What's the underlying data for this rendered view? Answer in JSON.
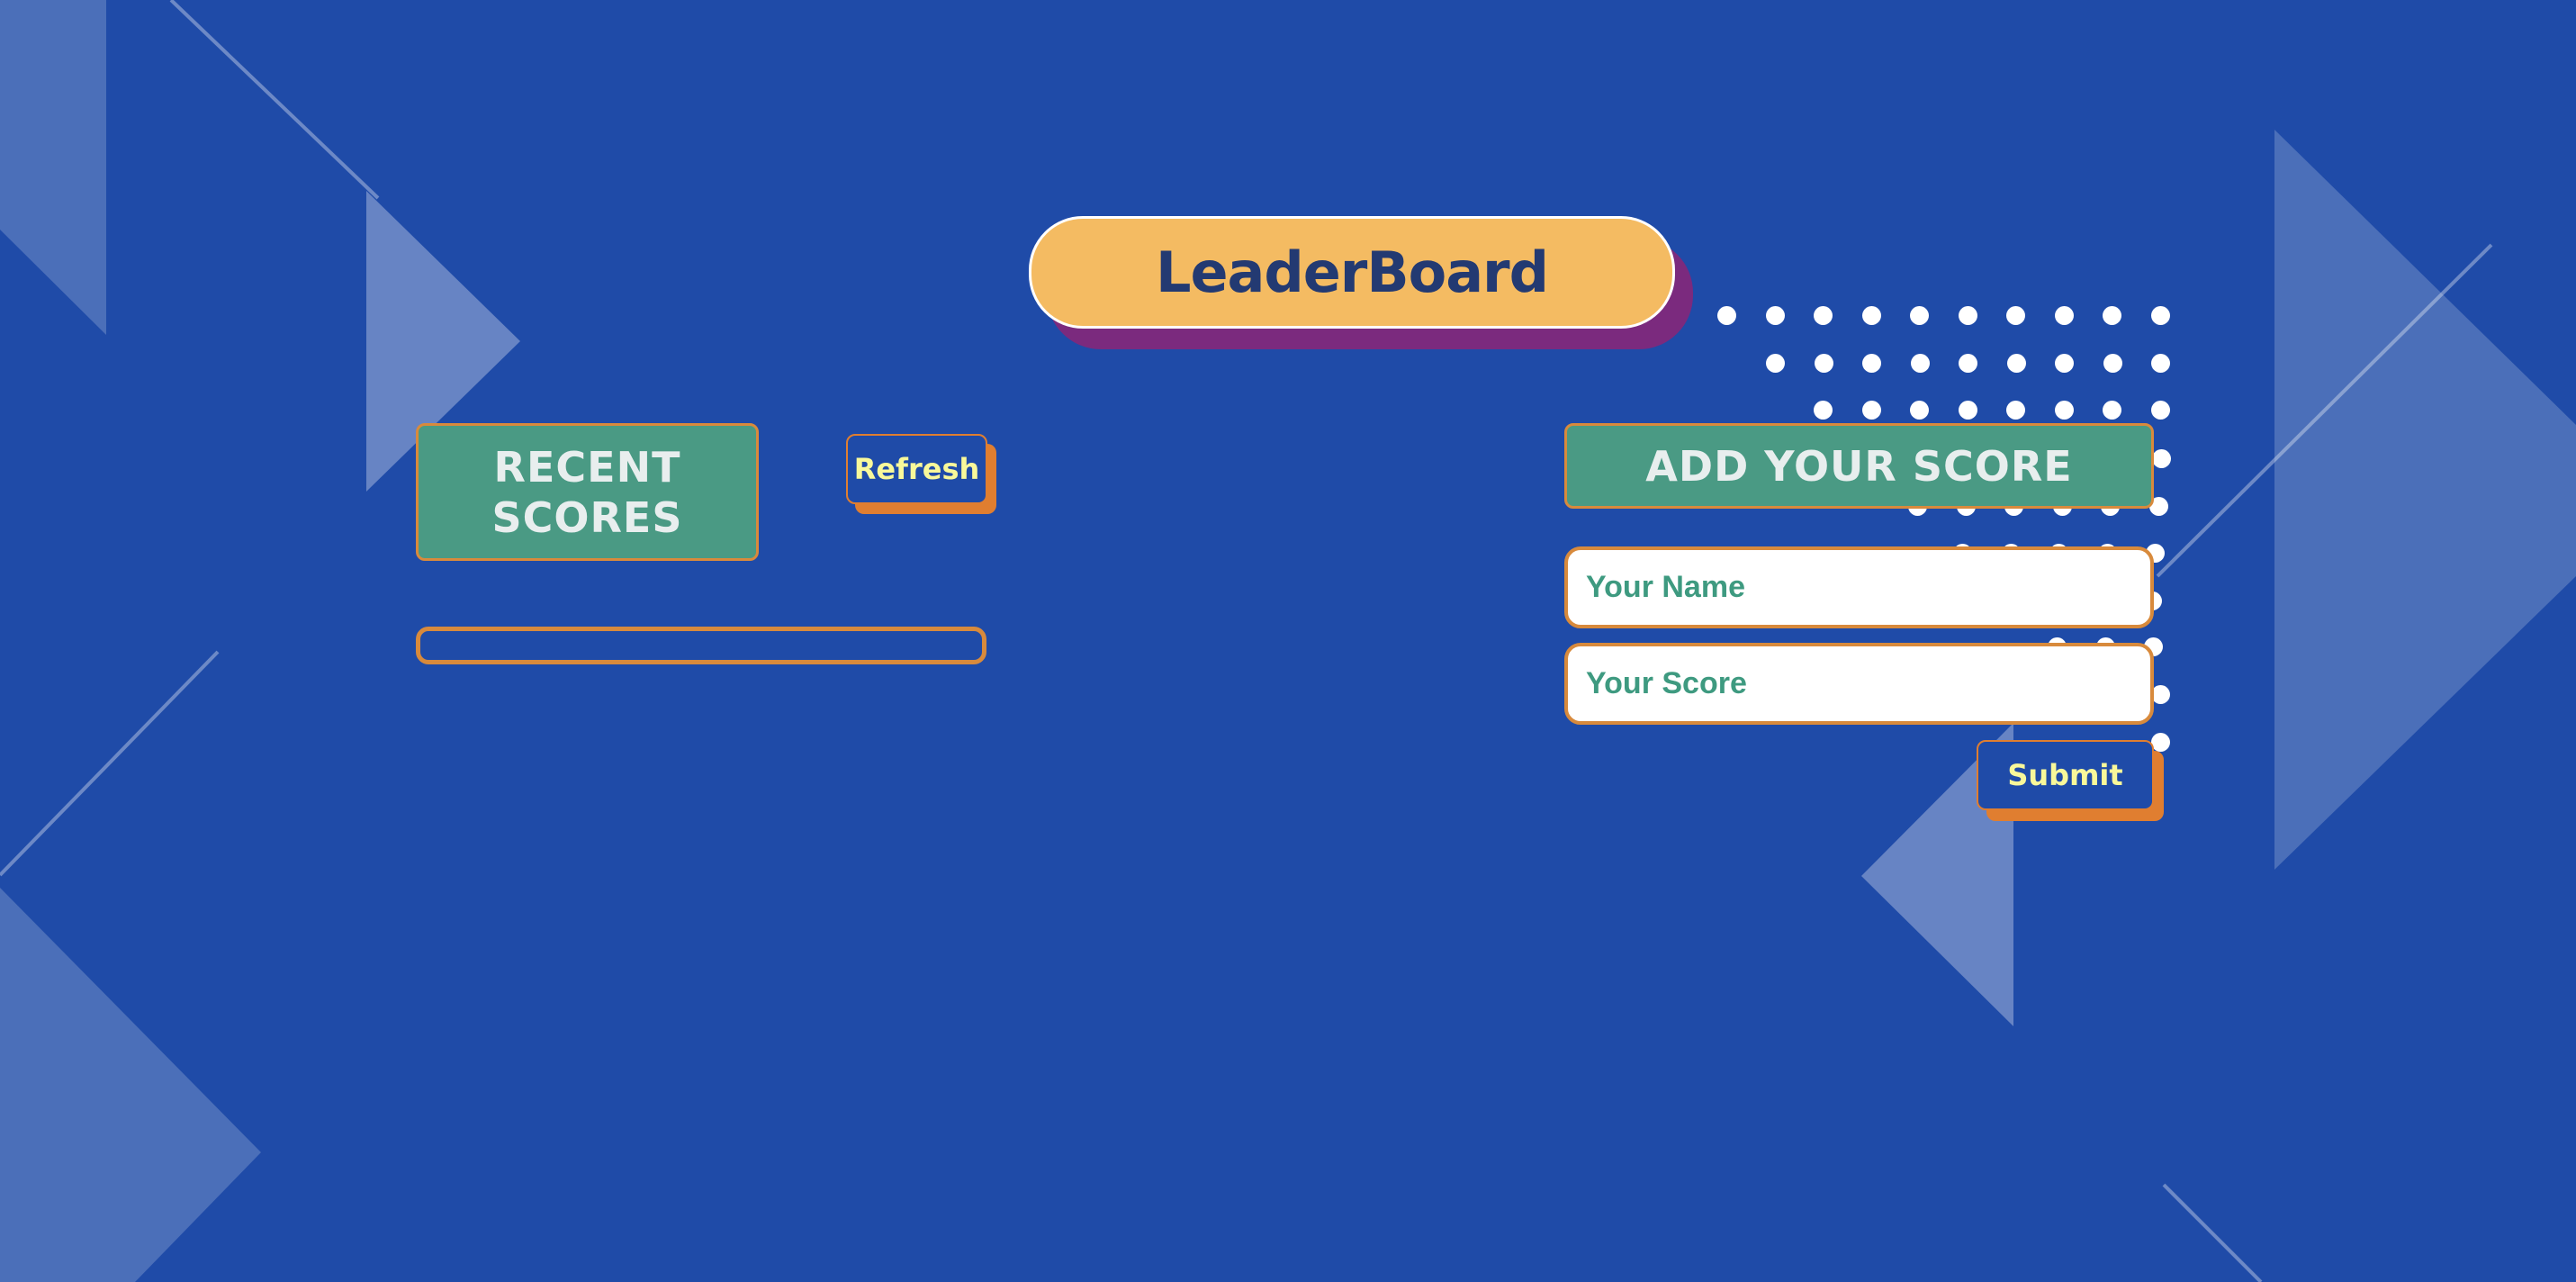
{
  "header": {
    "title": "LeaderBoard"
  },
  "recent": {
    "label_line1": "RECENT",
    "label_line2": "SCORES",
    "refresh_label": "Refresh",
    "scores": []
  },
  "add": {
    "label": "ADD YOUR SCORE",
    "name_placeholder": "Your Name",
    "score_placeholder": "Your Score",
    "submit_label": "Submit"
  },
  "colors": {
    "background": "#1f4ba8",
    "title_pill": "#f4bb62",
    "title_shadow": "#7b2a7e",
    "title_text": "#233a72",
    "section_label": "#4a9a84",
    "accent_orange": "#d88a3c",
    "button_text": "#f8f89a",
    "placeholder_text": "#3e9a80"
  }
}
